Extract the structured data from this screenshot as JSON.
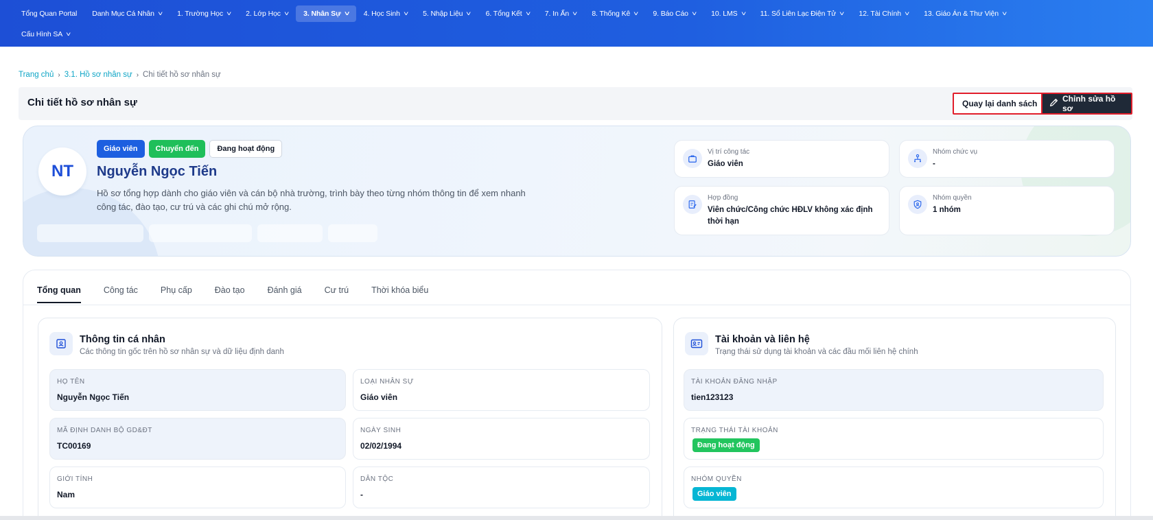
{
  "nav": {
    "row1": [
      {
        "label": "Tổng Quan Portal",
        "chevron": false,
        "active": false
      },
      {
        "label": "Danh Mục Cá Nhân",
        "chevron": true,
        "active": false
      },
      {
        "label": "1. Trường Học",
        "chevron": true,
        "active": false
      },
      {
        "label": "2. Lớp Học",
        "chevron": true,
        "active": false
      },
      {
        "label": "3. Nhân Sự",
        "chevron": true,
        "active": true
      },
      {
        "label": "4. Học Sinh",
        "chevron": true,
        "active": false
      },
      {
        "label": "5. Nhập Liệu",
        "chevron": true,
        "active": false
      },
      {
        "label": "6. Tổng Kết",
        "chevron": true,
        "active": false
      },
      {
        "label": "7. In Ấn",
        "chevron": true,
        "active": false
      },
      {
        "label": "8. Thống Kê",
        "chevron": true,
        "active": false
      },
      {
        "label": "9. Báo Cáo",
        "chevron": true,
        "active": false
      },
      {
        "label": "10. LMS",
        "chevron": true,
        "active": false
      },
      {
        "label": "11. Sổ Liên Lạc Điện Tử",
        "chevron": true,
        "active": false
      },
      {
        "label": "12. Tài Chính",
        "chevron": true,
        "active": false
      },
      {
        "label": "13. Giáo Án & Thư Viện",
        "chevron": true,
        "active": false
      }
    ],
    "row2": [
      {
        "label": "Cấu Hình SA",
        "chevron": true,
        "active": false
      }
    ]
  },
  "breadcrumb": {
    "home": "Trang chủ",
    "parent": "3.1. Hồ sơ nhân sự",
    "current": "Chi tiết hồ sơ nhân sự",
    "separator": "›"
  },
  "header": {
    "title": "Chi tiết hồ sơ nhân sự",
    "back_label": "Quay lại danh sách",
    "edit_label": "Chỉnh sửa hồ sơ"
  },
  "profile": {
    "initials": "NT",
    "badges": [
      "Giáo viên",
      "Chuyển đến",
      "Đang hoạt động"
    ],
    "name": "Nguyễn Ngọc Tiến",
    "description": "Hồ sơ tổng hợp dành cho giáo viên và cán bộ nhà trường, trình bày theo từng nhóm thông tin để xem nhanh công tác, đào tạo, cư trú và các ghi chú mở rộng.",
    "info": [
      {
        "label": "Vị trí công tác",
        "value": "Giáo viên",
        "icon": "briefcase-icon"
      },
      {
        "label": "Nhóm chức vụ",
        "value": "-",
        "icon": "org-chart-icon"
      },
      {
        "label": "Hợp đồng",
        "value": "Viên chức/Công chức HĐLV không xác định thời hạn",
        "icon": "contract-icon"
      },
      {
        "label": "Nhóm quyền",
        "value": "1 nhóm",
        "icon": "shield-user-icon"
      }
    ]
  },
  "tabs": [
    "Tổng quan",
    "Công tác",
    "Phụ cấp",
    "Đào tạo",
    "Đánh giá",
    "Cư trú",
    "Thời khóa biểu"
  ],
  "active_tab": "Tổng quan",
  "personal": {
    "title": "Thông tin cá nhân",
    "subtitle": "Các thông tin gốc trên hồ sơ nhân sự và dữ liệu định danh",
    "icon": "id-card-icon",
    "fields": [
      {
        "label": "HỌ TÊN",
        "value": "Nguyễn Ngọc Tiến"
      },
      {
        "label": "LOẠI NHÂN SỰ",
        "value": "Giáo viên"
      },
      {
        "label": "MÃ ĐỊNH DANH BỘ GD&ĐT",
        "value": "TC00169"
      },
      {
        "label": "NGÀY SINH",
        "value": "02/02/1994"
      },
      {
        "label": "GIỚI TÍNH",
        "value": "Nam"
      },
      {
        "label": "DÂN TỘC",
        "value": "-"
      }
    ]
  },
  "account": {
    "title": "Tài khoản và liên hệ",
    "subtitle": "Trạng thái sử dụng tài khoản và các đầu mối liên hệ chính",
    "icon": "contact-card-icon",
    "login_label": "TÀI KHOẢN ĐĂNG NHẬP",
    "login_value": "tien123123",
    "status_label": "TRẠNG THÁI TÀI KHOẢN",
    "status_value": "Đang hoạt động",
    "role_label": "NHÓM QUYỀN",
    "role_value": "Giáo viên"
  },
  "colors": {
    "nav_gradient_start": "#1d4fd6",
    "accent_blue": "#1d5fe0",
    "success_green": "#22c55e",
    "role_cyan": "#06b6d4",
    "highlight_red": "#e11d2a"
  }
}
